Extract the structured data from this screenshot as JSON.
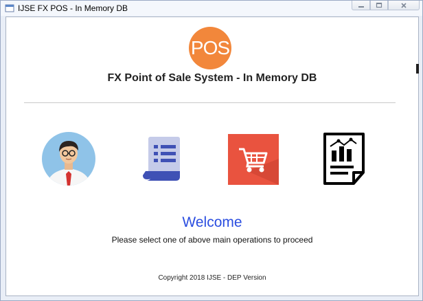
{
  "window": {
    "title": "IJSE FX POS - In Memory DB",
    "controls": [
      "minimize-icon",
      "maximize-icon",
      "close-icon"
    ]
  },
  "header": {
    "logo_text": "POS",
    "logo_color": "#f2873b",
    "title": "FX Point of Sale System - In Memory DB"
  },
  "operations": [
    {
      "icon": "customer-icon"
    },
    {
      "icon": "item-list-icon"
    },
    {
      "icon": "shopping-cart-icon"
    },
    {
      "icon": "report-icon"
    }
  ],
  "main": {
    "welcome": "Welcome",
    "subtitle": "Please select one of above main operations to proceed"
  },
  "footer": {
    "copyright": "Copyright 2018 IJSE - DEP Version"
  },
  "colors": {
    "accent_blue": "#2b4ee0",
    "cart_red": "#e9533f"
  }
}
